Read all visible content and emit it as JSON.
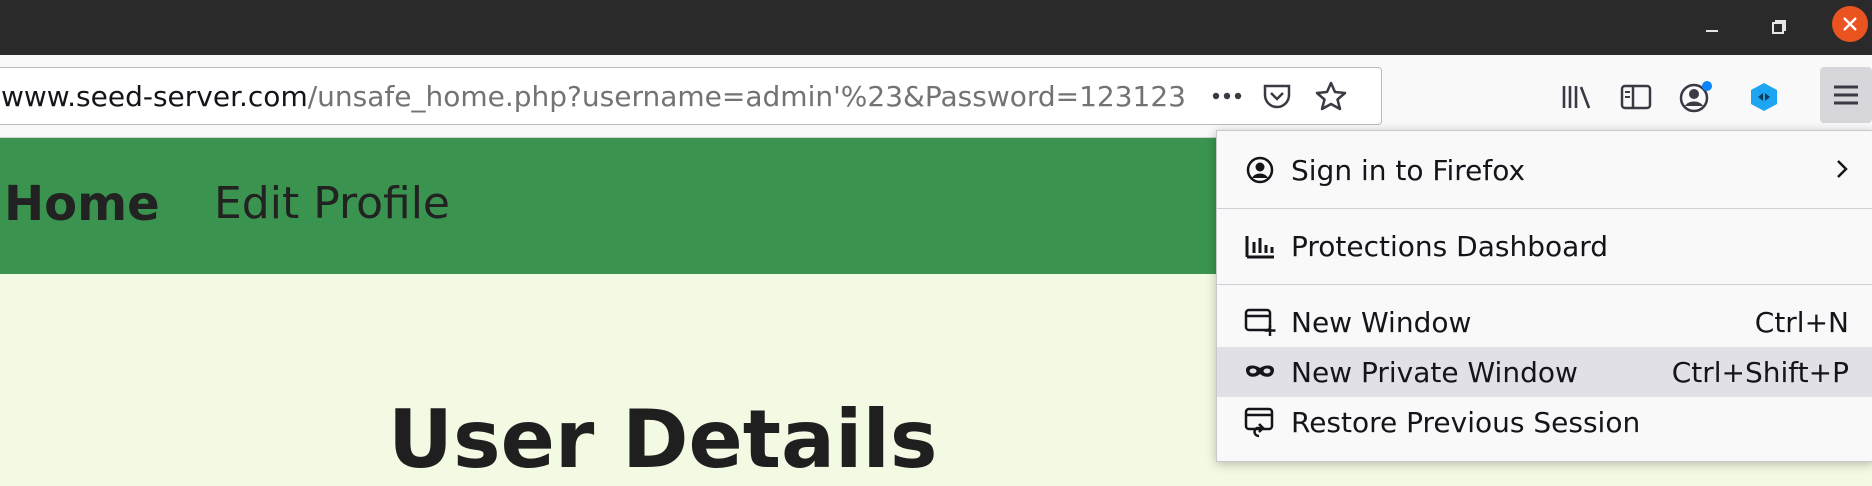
{
  "window": {
    "minimize": "minimize",
    "maximize": "maximize",
    "close": "close"
  },
  "toolbar": {
    "url_host": "www.seed-server.com",
    "url_path": "/unsafe_home.php?username=admin'%23&Password=123123",
    "icons": [
      "more-actions-icon",
      "pocket-icon",
      "bookmark-star-icon",
      "library-icon",
      "sidebar-icon",
      "account-icon",
      "extension-icon",
      "hamburger-menu-icon"
    ]
  },
  "page": {
    "nav_home": "Home",
    "nav_edit": "Edit Profile",
    "title": "User Details",
    "colors": {
      "navbar": "#3a944f",
      "background": "#f3fae3"
    }
  },
  "menu": {
    "sign_in": "Sign in to Firefox",
    "protections": "Protections Dashboard",
    "new_window": "New Window",
    "new_window_shortcut": "Ctrl+N",
    "new_private_window": "New Private Window",
    "new_private_window_shortcut": "Ctrl+Shift+P",
    "restore_session": "Restore Previous Session"
  }
}
